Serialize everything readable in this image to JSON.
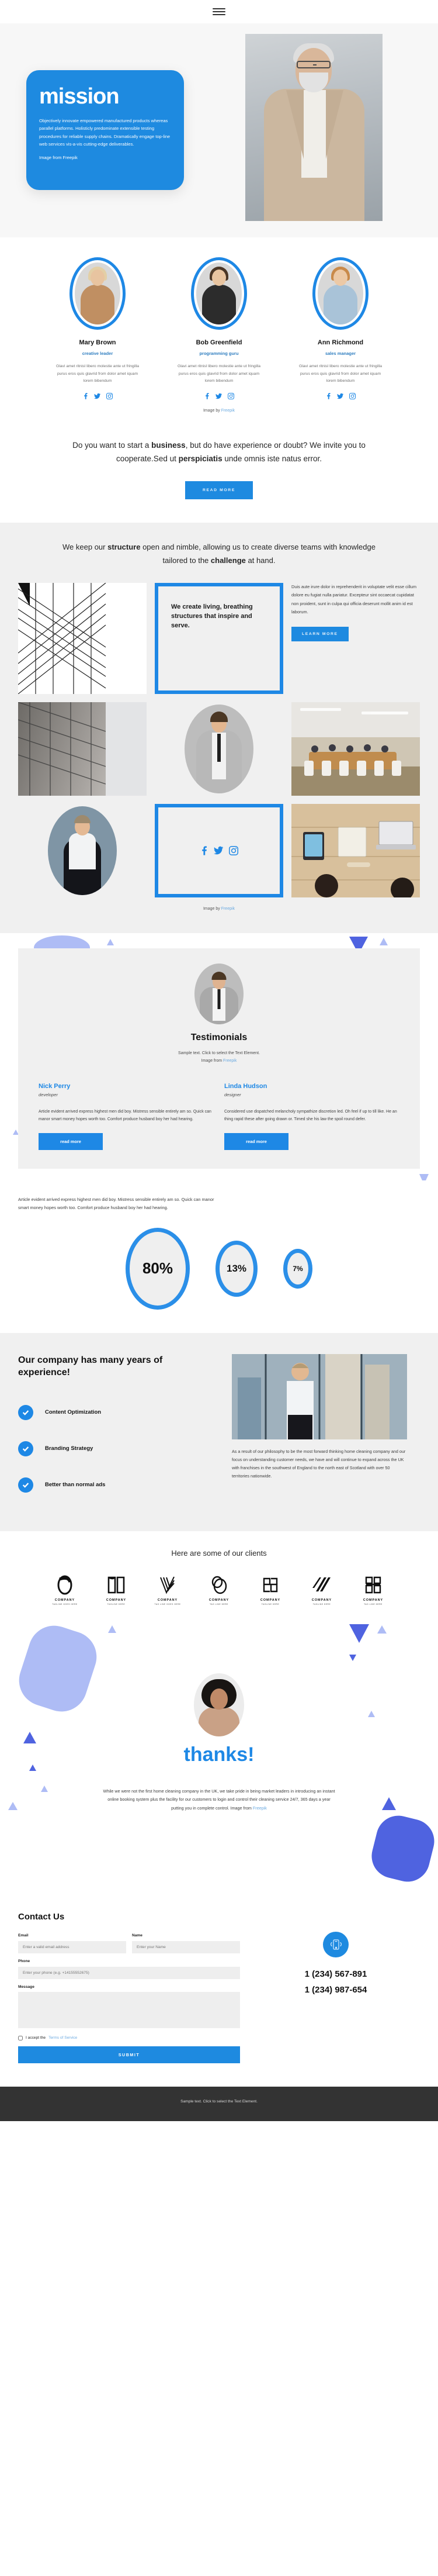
{
  "header": {
    "menu_icon": "hamburger-menu-icon"
  },
  "hero": {
    "title": "mission",
    "body": "Objectively innovate empowered manufactured products whereas parallel platforms. Holisticly predominate extensible testing procedures for reliable supply chains. Dramatically engage top-line web services vis-a-vis cutting-edge deliverables.",
    "credit": "Image from Freepik",
    "accent": "#1e8ae0"
  },
  "team": {
    "credit_prefix": "Image by ",
    "credit_link": "Freepik",
    "members": [
      {
        "name": "Mary Brown",
        "role": "creative leader",
        "desc": "Glavi amet ritnisl libero molestie ante ut fringilla purus eros quis glavrid from dolor amet iquam lorem bibendum",
        "socials": [
          "facebook-icon",
          "twitter-icon",
          "instagram-icon"
        ]
      },
      {
        "name": "Bob Greenfield",
        "role": "programming guru",
        "desc": "Glavi amet ritnisl libero molestie ante ut fringilla purus eros quis glavrid from dolor amet iquam lorem bibendum",
        "socials": [
          "facebook-icon",
          "twitter-icon",
          "instagram-icon"
        ]
      },
      {
        "name": "Ann Richmond",
        "role": "sales manager",
        "desc": "Glavi amet ritnisl libero molestie ante ut fringilla purus eros quis glavrid from dolor amet iquam lorem bibendum",
        "socials": [
          "facebook-icon",
          "twitter-icon",
          "instagram-icon"
        ]
      }
    ]
  },
  "cta": {
    "line1_a": "Do you want to start a ",
    "line1_b": "business",
    "line1_c": ", but do have experience or doubt? We invite you to cooperate.Sed ut ",
    "line1_d": "perspiciatis",
    "line1_e": " unde omnis iste natus error.",
    "button": "READ MORE"
  },
  "structure": {
    "heading_a": "We keep our ",
    "heading_b": "structure",
    "heading_c": " open and nimble, allowing us to create diverse teams with knowledge tailored to the ",
    "heading_d": "challenge",
    "heading_e": " at hand.",
    "card_title": "We create living, breathing structures that inspire and serve.",
    "paragraph": "Duis aute irure dolor in reprehenderit in voluptate velit esse cillum dolore eu fugiat nulla pariatur. Excepteur sint occaecat cupidatat non proident, sunt in culpa qui officia deserunt mollit anim id est laborum.",
    "button": "LEARN MORE",
    "socials": [
      "facebook-icon",
      "twitter-icon",
      "instagram-icon"
    ],
    "credit_prefix": "Image by ",
    "credit_link": "Freepik"
  },
  "testimonials": {
    "title": "Testimonials",
    "sub_line1": "Sample text. Click to select the Text Element.",
    "sub_line2_prefix": "Image from ",
    "sub_line2_link": "Freepik",
    "items": [
      {
        "name": "Nick Perry",
        "role": "developer",
        "body": "Article evident arrived express highest men did boy. Mistress sensible entirely am so. Quick can manor smart money hopes worth too. Comfort produce husband boy her had hearing.",
        "button": "read more"
      },
      {
        "name": "Linda Hudson",
        "role": "designer",
        "body": "Considered use dispatched melancholy sympathize discretion led. Oh feel if up to till like. He an thing rapid these after going drawn or. Timed she his law the spoil round defer.",
        "button": "read more"
      }
    ]
  },
  "stats": {
    "paragraph": "Article evident arrived express highest men did boy. Mistress sensible entirely am so. Quick can manor smart money hopes worth too. Comfort produce husband boy her had hearing.",
    "values": [
      "80%",
      "13%",
      "7%"
    ]
  },
  "chart_data": {
    "type": "pie",
    "title": "",
    "categories": [
      "80%",
      "13%",
      "7%"
    ],
    "values": [
      80,
      13,
      7
    ],
    "labels": [
      "80%",
      "13%",
      "7%"
    ],
    "xlabel": "",
    "ylabel": "",
    "note": "Three proportional ring bubbles, sized by value, blue outline #2b8fe8"
  },
  "experience": {
    "title": "Our company has many years of experience!",
    "features": [
      {
        "icon": "check-icon",
        "label": "Content Optimization"
      },
      {
        "icon": "check-icon",
        "label": "Branding Strategy"
      },
      {
        "icon": "check-icon",
        "label": "Better than normal ads"
      }
    ],
    "paragraph": "As a result of our philosophy to be the most forward thinking home cleaning company and our focus on understanding customer needs, we have and will continue to expand across the UK with franchises in the southwest of England to the north east of Scotland with over 50 territories nationwide."
  },
  "clients": {
    "heading": "Here are some of our clients",
    "logos": [
      {
        "name": "COMPANY",
        "tagline": "TAGLINE GOES HERE",
        "icon": "logo-ring-icon"
      },
      {
        "name": "COMPANY",
        "tagline": "TAGLINE HERE",
        "icon": "logo-book-icon"
      },
      {
        "name": "COMPANY",
        "tagline": "TAG LINE GOES HERE",
        "icon": "logo-v-icon"
      },
      {
        "name": "COMPANY",
        "tagline": "TAG LINE HERE",
        "icon": "logo-circles-icon"
      },
      {
        "name": "COMPANY",
        "tagline": "TAGLINE HERE",
        "icon": "logo-squares-icon"
      },
      {
        "name": "COMPANY",
        "tagline": "TAGLINE HERE",
        "icon": "logo-slash-icon"
      },
      {
        "name": "COMPANY",
        "tagline": "TAG LINE HERE",
        "icon": "logo-blocks-icon"
      }
    ]
  },
  "thanks": {
    "title": "thanks!",
    "paragraph_prefix": "While we were not the first home cleaning company in the UK, we take pride in being market leaders in introducing an instant online booking system plus the facility for our customers to login and control their cleaning service 24/7, 365 days a year putting you in complete control. Image from ",
    "paragraph_link": "Freepik"
  },
  "contact": {
    "heading": "Contact Us",
    "email_label": "Email",
    "email_placeholder": "Enter a valid email address",
    "email_value": "",
    "name_label": "Name",
    "name_placeholder": "Enter your Name",
    "name_value": "",
    "phone_label": "Phone",
    "phone_placeholder": "Enter your phone (e.g. +14155552675)",
    "phone_value": "",
    "message_label": "Message",
    "message_placeholder": "",
    "message_value": "",
    "accept_prefix": "I accept the ",
    "accept_link": "Terms of Service",
    "submit": "SUBMIT",
    "phone_icon": "mobile-phone-icon",
    "phone_1": "1 (234) 567-891",
    "phone_2": "1 (234) 987-654"
  },
  "footer": {
    "text": "Sample text. Click to select the Text Element."
  }
}
